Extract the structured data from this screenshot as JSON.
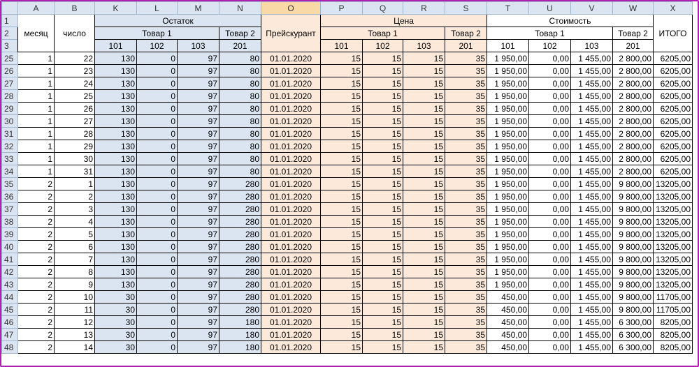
{
  "columns": [
    "A",
    "B",
    "K",
    "L",
    "M",
    "N",
    "O",
    "P",
    "Q",
    "R",
    "S",
    "T",
    "U",
    "V",
    "W",
    "X"
  ],
  "headers": {
    "month": "месяц",
    "day": "число",
    "stock": "Остаток",
    "pricelist": "Прейскурант",
    "price": "Цена",
    "cost": "Стоимость",
    "product1": "Товар 1",
    "product2": "Товар 2",
    "total": "ИТОГО",
    "codes": [
      "101",
      "102",
      "103",
      "201"
    ]
  },
  "rows": [
    {
      "r": "25",
      "c": [
        "1",
        "22",
        "130",
        "0",
        "97",
        "80",
        "01.01.2020",
        "15",
        "15",
        "15",
        "35",
        "1 950,00",
        "0,00",
        "1 455,00",
        "2 800,00",
        "6205,00"
      ]
    },
    {
      "r": "26",
      "c": [
        "1",
        "23",
        "130",
        "0",
        "97",
        "80",
        "01.01.2020",
        "15",
        "15",
        "15",
        "35",
        "1 950,00",
        "0,00",
        "1 455,00",
        "2 800,00",
        "6205,00"
      ]
    },
    {
      "r": "27",
      "c": [
        "1",
        "24",
        "130",
        "0",
        "97",
        "80",
        "01.01.2020",
        "15",
        "15",
        "15",
        "35",
        "1 950,00",
        "0,00",
        "1 455,00",
        "2 800,00",
        "6205,00"
      ]
    },
    {
      "r": "28",
      "c": [
        "1",
        "25",
        "130",
        "0",
        "97",
        "80",
        "01.01.2020",
        "15",
        "15",
        "15",
        "35",
        "1 950,00",
        "0,00",
        "1 455,00",
        "2 800,00",
        "6205,00"
      ]
    },
    {
      "r": "29",
      "c": [
        "1",
        "26",
        "130",
        "0",
        "97",
        "80",
        "01.01.2020",
        "15",
        "15",
        "15",
        "35",
        "1 950,00",
        "0,00",
        "1 455,00",
        "2 800,00",
        "6205,00"
      ]
    },
    {
      "r": "30",
      "c": [
        "1",
        "27",
        "130",
        "0",
        "97",
        "80",
        "01.01.2020",
        "15",
        "15",
        "15",
        "35",
        "1 950,00",
        "0,00",
        "1 455,00",
        "2 800,00",
        "6205,00"
      ]
    },
    {
      "r": "31",
      "c": [
        "1",
        "28",
        "130",
        "0",
        "97",
        "80",
        "01.01.2020",
        "15",
        "15",
        "15",
        "35",
        "1 950,00",
        "0,00",
        "1 455,00",
        "2 800,00",
        "6205,00"
      ]
    },
    {
      "r": "32",
      "c": [
        "1",
        "29",
        "130",
        "0",
        "97",
        "80",
        "01.01.2020",
        "15",
        "15",
        "15",
        "35",
        "1 950,00",
        "0,00",
        "1 455,00",
        "2 800,00",
        "6205,00"
      ]
    },
    {
      "r": "33",
      "c": [
        "1",
        "30",
        "130",
        "0",
        "97",
        "80",
        "01.01.2020",
        "15",
        "15",
        "15",
        "35",
        "1 950,00",
        "0,00",
        "1 455,00",
        "2 800,00",
        "6205,00"
      ]
    },
    {
      "r": "34",
      "c": [
        "1",
        "31",
        "130",
        "0",
        "97",
        "80",
        "01.01.2020",
        "15",
        "15",
        "15",
        "35",
        "1 950,00",
        "0,00",
        "1 455,00",
        "2 800,00",
        "6205,00"
      ]
    },
    {
      "r": "35",
      "c": [
        "2",
        "1",
        "130",
        "0",
        "97",
        "280",
        "01.01.2020",
        "15",
        "15",
        "15",
        "35",
        "1 950,00",
        "0,00",
        "1 455,00",
        "9 800,00",
        "13205,00"
      ]
    },
    {
      "r": "36",
      "c": [
        "2",
        "2",
        "130",
        "0",
        "97",
        "280",
        "01.01.2020",
        "15",
        "15",
        "15",
        "35",
        "1 950,00",
        "0,00",
        "1 455,00",
        "9 800,00",
        "13205,00"
      ]
    },
    {
      "r": "37",
      "c": [
        "2",
        "3",
        "130",
        "0",
        "97",
        "280",
        "01.01.2020",
        "15",
        "15",
        "15",
        "35",
        "1 950,00",
        "0,00",
        "1 455,00",
        "9 800,00",
        "13205,00"
      ]
    },
    {
      "r": "38",
      "c": [
        "2",
        "4",
        "130",
        "0",
        "97",
        "280",
        "01.01.2020",
        "15",
        "15",
        "15",
        "35",
        "1 950,00",
        "0,00",
        "1 455,00",
        "9 800,00",
        "13205,00"
      ]
    },
    {
      "r": "39",
      "c": [
        "2",
        "5",
        "130",
        "0",
        "97",
        "280",
        "01.01.2020",
        "15",
        "15",
        "15",
        "35",
        "1 950,00",
        "0,00",
        "1 455,00",
        "9 800,00",
        "13205,00"
      ]
    },
    {
      "r": "40",
      "c": [
        "2",
        "6",
        "130",
        "0",
        "97",
        "280",
        "01.01.2020",
        "15",
        "15",
        "15",
        "35",
        "1 950,00",
        "0,00",
        "1 455,00",
        "9 800,00",
        "13205,00"
      ]
    },
    {
      "r": "41",
      "c": [
        "2",
        "7",
        "130",
        "0",
        "97",
        "280",
        "01.01.2020",
        "15",
        "15",
        "15",
        "35",
        "1 950,00",
        "0,00",
        "1 455,00",
        "9 800,00",
        "13205,00"
      ]
    },
    {
      "r": "42",
      "c": [
        "2",
        "8",
        "130",
        "0",
        "97",
        "280",
        "01.01.2020",
        "15",
        "15",
        "15",
        "35",
        "1 950,00",
        "0,00",
        "1 455,00",
        "9 800,00",
        "13205,00"
      ]
    },
    {
      "r": "43",
      "c": [
        "2",
        "9",
        "130",
        "0",
        "97",
        "280",
        "01.01.2020",
        "15",
        "15",
        "15",
        "35",
        "1 950,00",
        "0,00",
        "1 455,00",
        "9 800,00",
        "13205,00"
      ]
    },
    {
      "r": "44",
      "c": [
        "2",
        "10",
        "30",
        "0",
        "97",
        "280",
        "01.01.2020",
        "15",
        "15",
        "15",
        "35",
        "450,00",
        "0,00",
        "1 455,00",
        "9 800,00",
        "11705,00"
      ]
    },
    {
      "r": "45",
      "c": [
        "2",
        "11",
        "30",
        "0",
        "97",
        "280",
        "01.01.2020",
        "15",
        "15",
        "15",
        "35",
        "450,00",
        "0,00",
        "1 455,00",
        "9 800,00",
        "11705,00"
      ]
    },
    {
      "r": "46",
      "c": [
        "2",
        "12",
        "30",
        "0",
        "97",
        "180",
        "01.01.2020",
        "15",
        "15",
        "15",
        "35",
        "450,00",
        "0,00",
        "1 455,00",
        "6 300,00",
        "8205,00"
      ]
    },
    {
      "r": "47",
      "c": [
        "2",
        "13",
        "30",
        "0",
        "97",
        "180",
        "01.01.2020",
        "15",
        "15",
        "15",
        "35",
        "450,00",
        "0,00",
        "1 455,00",
        "6 300,00",
        "8205,00"
      ]
    },
    {
      "r": "48",
      "c": [
        "2",
        "14",
        "30",
        "0",
        "97",
        "180",
        "01.01.2020",
        "15",
        "15",
        "15",
        "35",
        "450,00",
        "0,00",
        "1 455,00",
        "6 300,00",
        "8205,00"
      ]
    }
  ]
}
